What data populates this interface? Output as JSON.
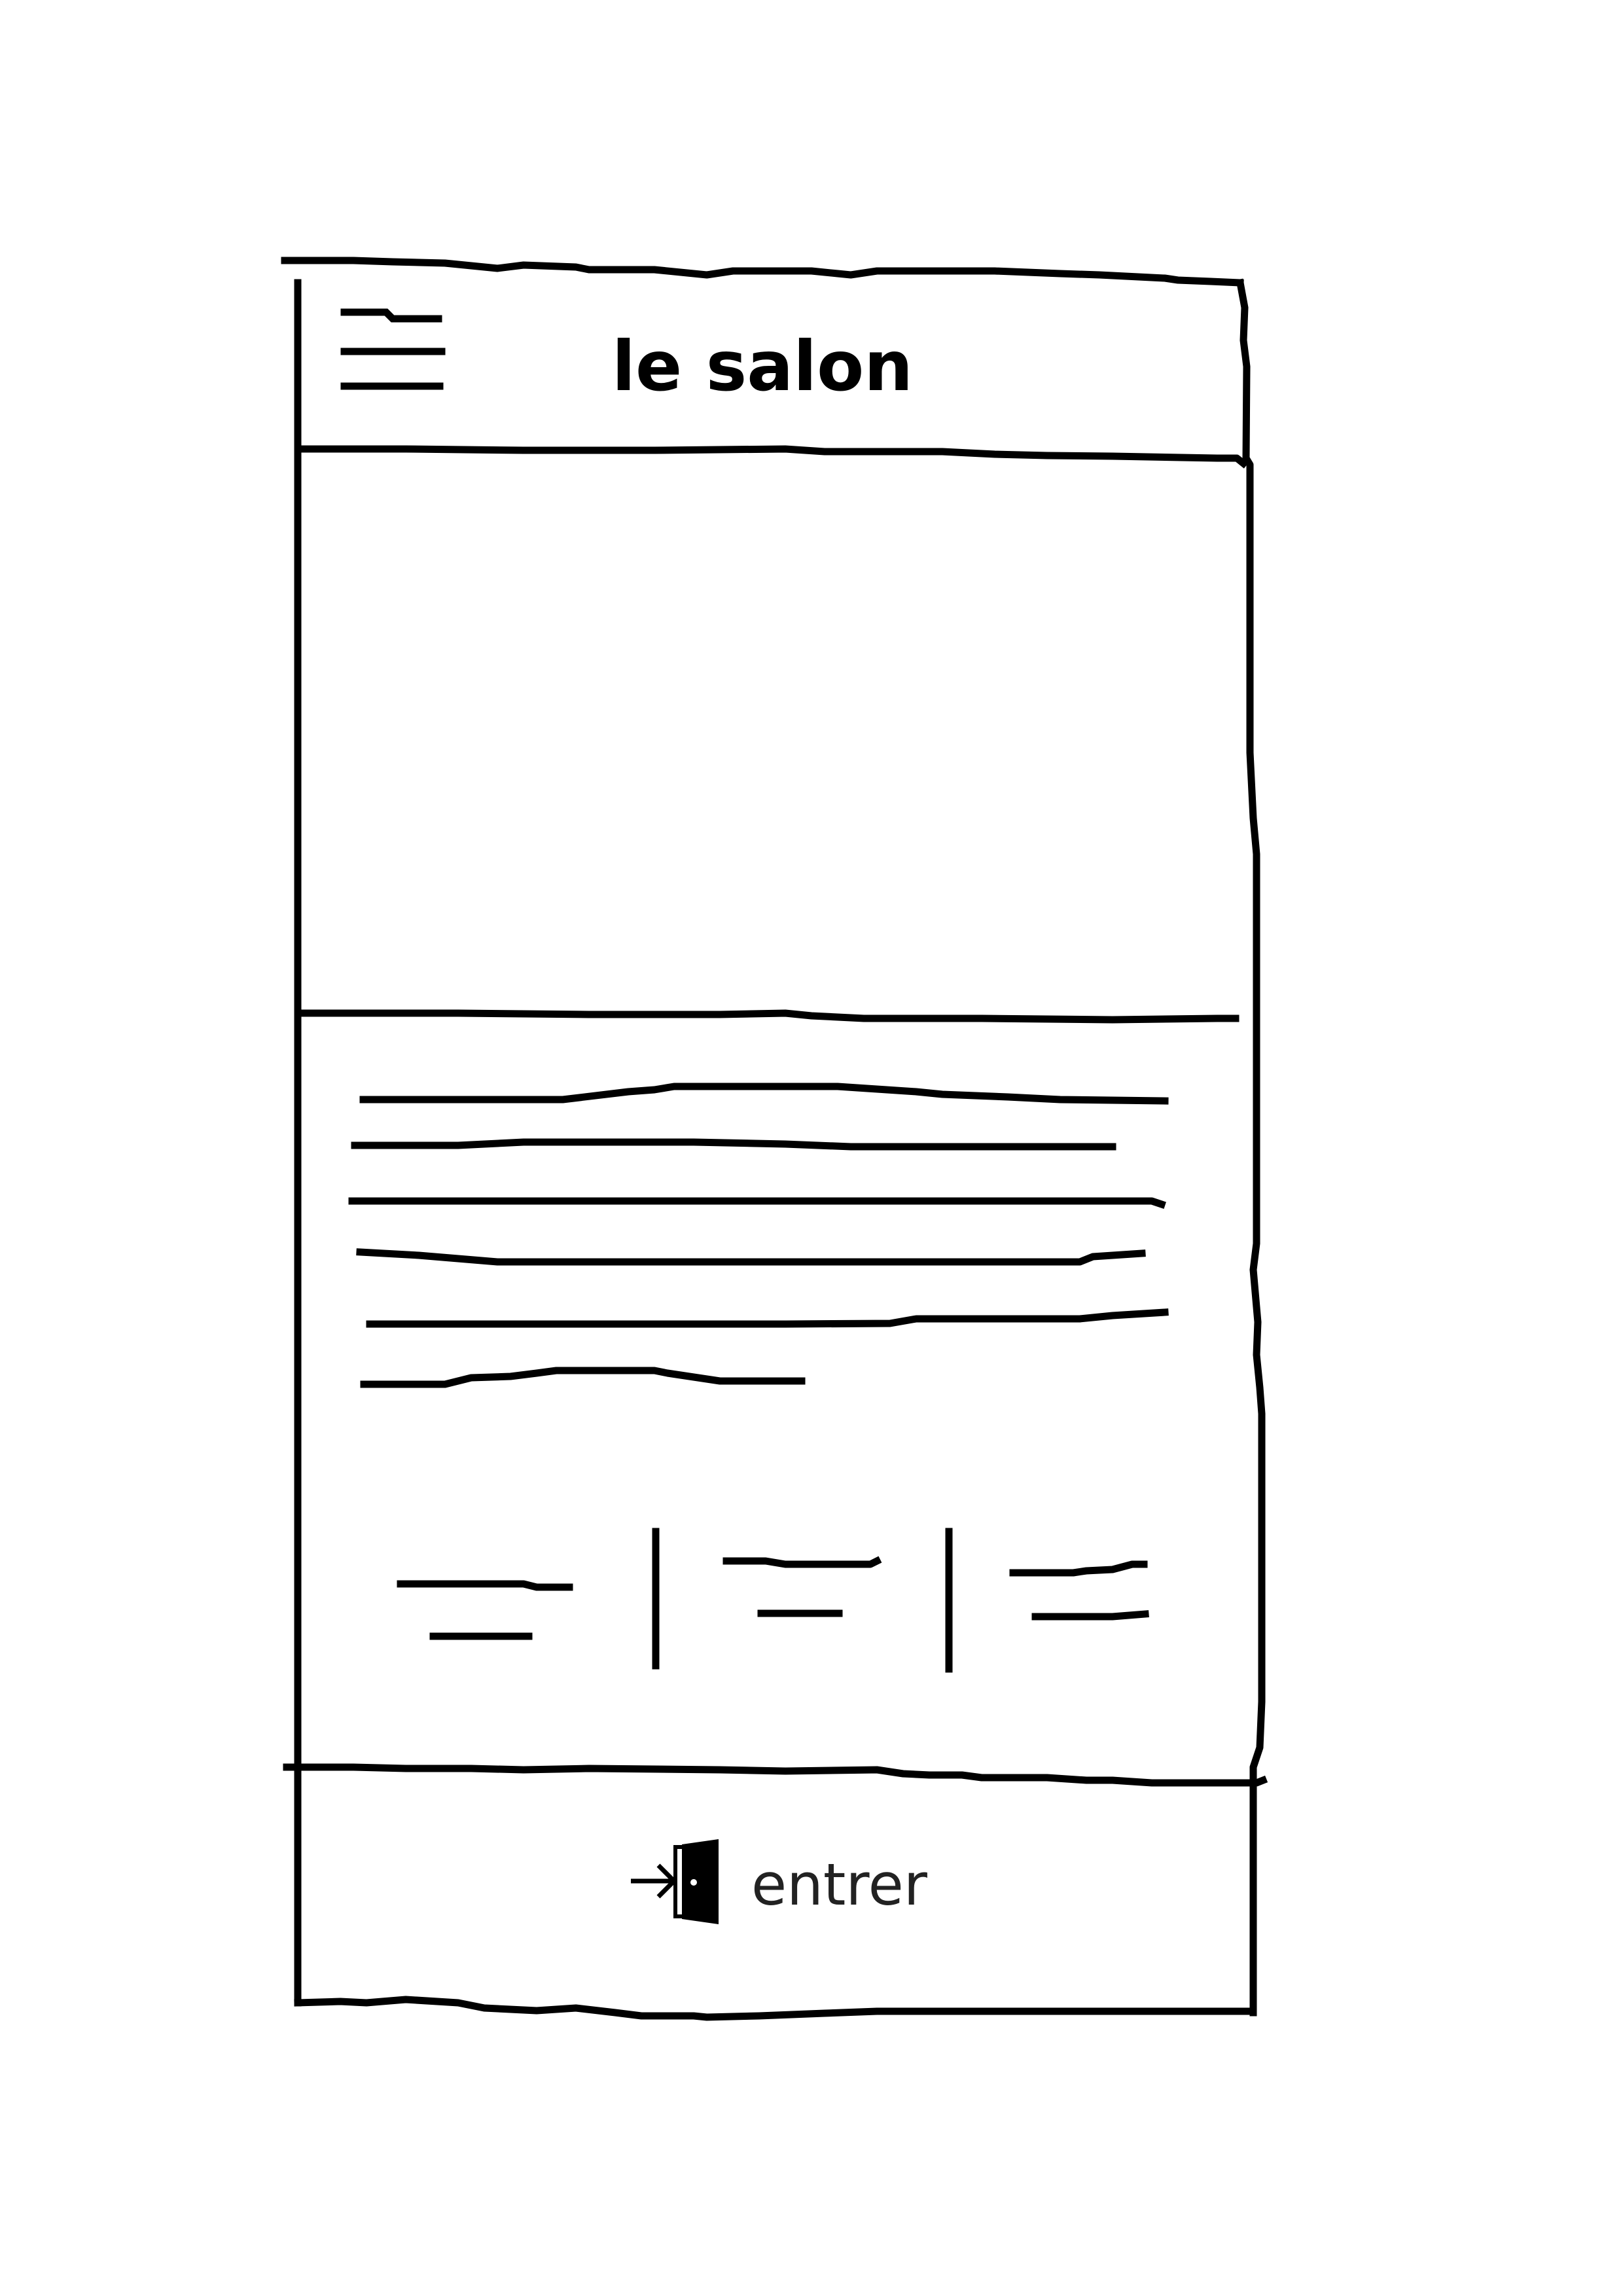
{
  "header": {
    "title": "le salon",
    "menu_icon": "hamburger-menu-icon"
  },
  "footer": {
    "enter_label": "entrer",
    "enter_icon": "door-enter-icon"
  },
  "colors": {
    "ink": "#000000",
    "paper": "#ffffff"
  }
}
